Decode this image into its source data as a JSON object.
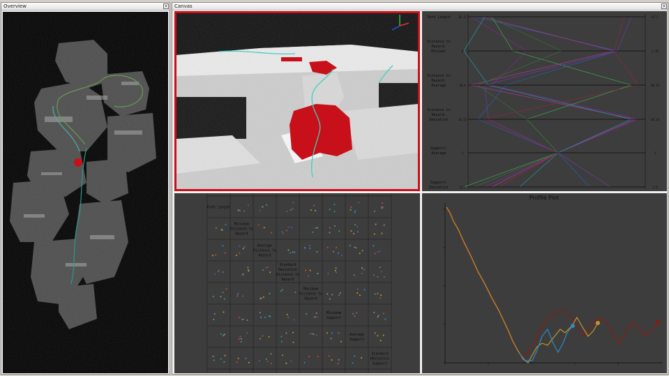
{
  "overview": {
    "title": "Overview",
    "close": "×"
  },
  "canvas": {
    "title": "Canvas",
    "close": "×"
  },
  "parallel": {
    "axes": [
      {
        "label": [
          "Path Length"
        ],
        "left": "16.11",
        "right": "67.5"
      },
      {
        "label": [
          "Distance to",
          "Hazard:",
          "Minimal"
        ],
        "left": "0",
        "right": "3.16"
      },
      {
        "label": [
          "Distance to",
          "Hazard:",
          "Average"
        ],
        "left": "20.4",
        "right": "36.12"
      },
      {
        "label": [
          "Distance to",
          "Hazard:",
          "Deviation"
        ],
        "left": "14.55",
        "right": "28.13"
      },
      {
        "label": [
          "Support:",
          "Average"
        ],
        "left": "1",
        "right": "1"
      },
      {
        "label": [
          "Support:",
          "Deviation"
        ],
        "left": "0.5",
        "right": "3.9"
      }
    ]
  },
  "scatter": {
    "labels": [
      [
        "Path Length"
      ],
      [
        "Minimum",
        "Distance to",
        "Hazard"
      ],
      [
        "Average",
        "Distance to",
        "Hazard"
      ],
      [
        "Standard",
        "Deviation",
        "Distance to",
        "Hazard"
      ],
      [
        "Maximum",
        "Distance to",
        "Hazard"
      ],
      [
        "Minimum",
        "Support"
      ],
      [
        "Average",
        "Support"
      ],
      [
        "Standard",
        "Deviation",
        "Support"
      ]
    ]
  },
  "profile": {
    "title": "Profile Plot"
  },
  "colors": {
    "accent_red": "#c8101a",
    "line_brown": "#8a1b14",
    "line_orange": "#c89428",
    "line_blue": "#2a8cc8",
    "line_first": "#c07a2a"
  }
}
